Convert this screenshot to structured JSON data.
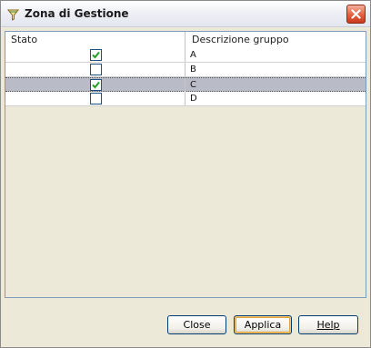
{
  "window": {
    "title": "Zona di Gestione",
    "title_icon": "funnel-icon",
    "close_icon": "close-icon"
  },
  "table": {
    "columns": [
      "Stato",
      "Descrizione gruppo"
    ],
    "rows": [
      {
        "checked": true,
        "label": "A",
        "selected": false
      },
      {
        "checked": false,
        "label": "B",
        "selected": false
      },
      {
        "checked": true,
        "label": "C",
        "selected": true
      },
      {
        "checked": false,
        "label": "D",
        "selected": false
      }
    ]
  },
  "buttons": {
    "close": "Close",
    "apply": "Applica",
    "help": "Help"
  },
  "colors": {
    "checkmark": "#21a121",
    "selection": "#b9bcc6",
    "close_button": "#d9553a"
  }
}
